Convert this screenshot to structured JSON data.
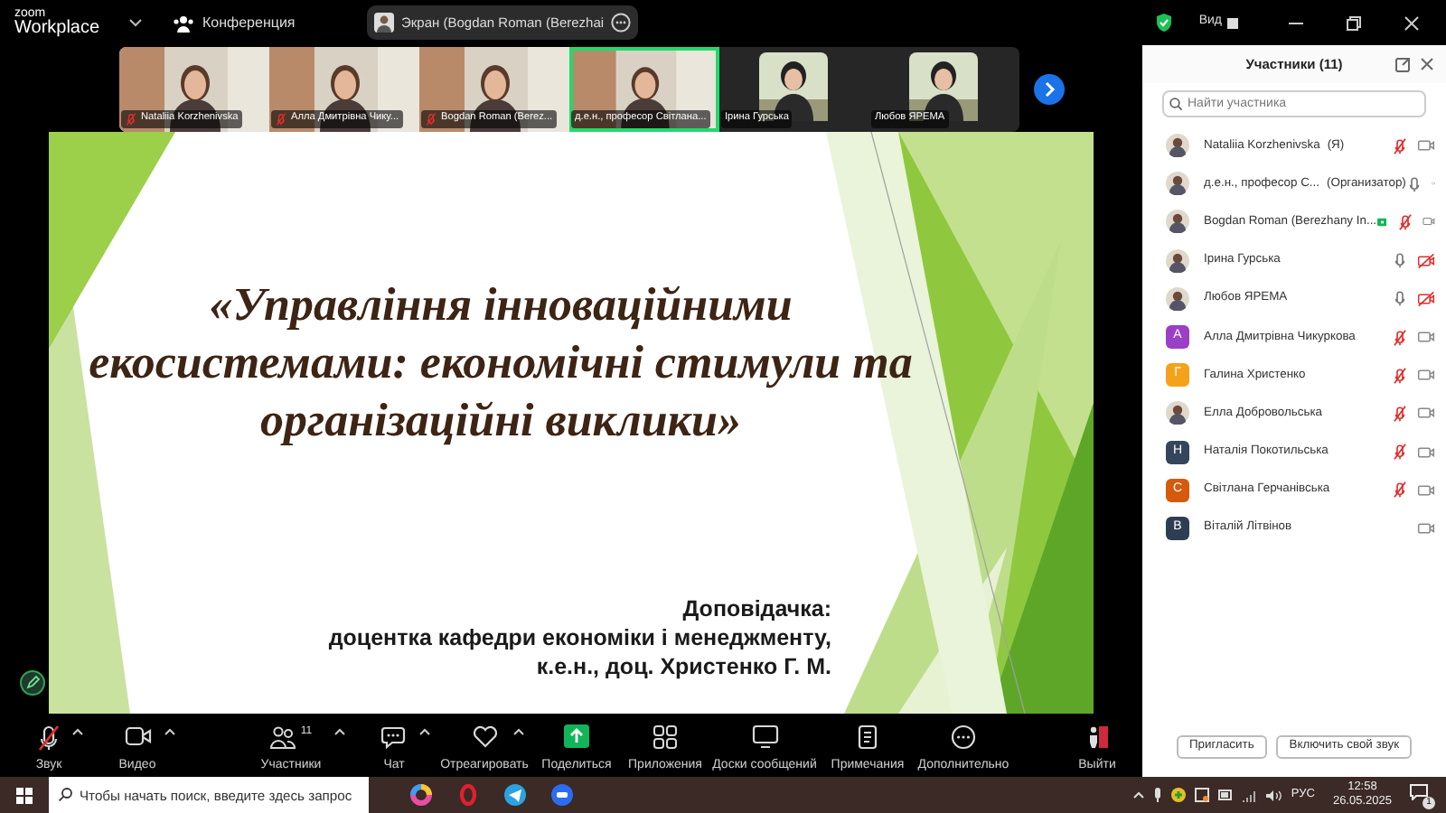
{
  "app": {
    "logo_top": "zoom",
    "logo_bottom": "Workplace",
    "meeting_label": "Конференция"
  },
  "share_pill": {
    "text": "Экран (Bogdan Roman (Berezhai"
  },
  "window_controls": {
    "view_label": "Вид"
  },
  "video_strip": [
    {
      "kind": "video",
      "name": "Nataliia Korzhenivska",
      "muted": true,
      "speaking": false
    },
    {
      "kind": "video",
      "name": "Алла Дмитрівна Чику...",
      "muted": true,
      "speaking": false
    },
    {
      "kind": "video",
      "name": "Bogdan Roman (Berez...",
      "muted": true,
      "speaking": false
    },
    {
      "kind": "video",
      "name": "д.е.н., професор Світлана...",
      "muted": false,
      "speaking": true
    },
    {
      "name": "Ірина Гурська",
      "muted": false,
      "speaking": false
    },
    {
      "name": "Любов ЯРЕМА",
      "muted": false,
      "speaking": false
    }
  ],
  "slide": {
    "title_lines": [
      "«Управління інноваційними",
      "екосистемами: економічні стимули та",
      "організаційні виклики»"
    ],
    "presenter_lines": [
      "Доповідачка:",
      "доцентка кафедри економіки і менеджменту,",
      "к.е.н., доц. Христенко Г. М."
    ]
  },
  "participants_panel": {
    "title": "Участники (11)",
    "search": {
      "placeholder": "Найти участника"
    },
    "items": [
      {
        "name": "Nataliia Korzhenivska",
        "role": "(Я)",
        "has_audio": true,
        "muted": true,
        "video_off": false,
        "sharing": false
      },
      {
        "name": "д.е.н., професор С...",
        "role": "(Организатор)",
        "has_audio": true,
        "muted": false,
        "video_off": false,
        "sharing": false
      },
      {
        "name": "Bogdan Roman (Berezhany In...",
        "has_audio": true,
        "muted": true,
        "video_off": false,
        "sharing": true
      },
      {
        "name": "Ірина Гурська",
        "has_audio": true,
        "muted": false,
        "video_off": true,
        "sharing": false
      },
      {
        "name": "Любов ЯРЕМА",
        "has_audio": true,
        "muted": false,
        "video_off": true,
        "sharing": false
      },
      {
        "letter": "А",
        "color": "#9b3fc6",
        "name": "Алла Дмитрівна Чикуркова",
        "has_audio": true,
        "muted": true,
        "video_off": false,
        "sharing": false
      },
      {
        "letter": "Г",
        "color": "#f5a21b",
        "name": "Галина Христенко",
        "has_audio": true,
        "muted": true,
        "video_off": false,
        "sharing": false
      },
      {
        "name": "Елла Добровольська",
        "has_audio": true,
        "muted": true,
        "video_off": false,
        "sharing": false
      },
      {
        "letter": "Н",
        "color": "#34465c",
        "name": "Наталія Покотильська",
        "has_audio": true,
        "muted": true,
        "video_off": false,
        "sharing": false
      },
      {
        "letter": "С",
        "color": "#d55a0c",
        "name": "Світлана Герчанівська",
        "has_audio": true,
        "muted": true,
        "video_off": false,
        "sharing": false
      },
      {
        "letter": "В",
        "color": "#2e3e52",
        "name": "Віталій Літвінов",
        "has_audio": false,
        "video_off": false,
        "sharing": false
      }
    ],
    "buttons": [
      "Пригласить",
      "Включить свой звук"
    ]
  },
  "toolbar": [
    {
      "kind": "mic-muted",
      "label": "Звук",
      "caret": true
    },
    {
      "kind": "video",
      "label": "Видео",
      "caret": true
    },
    {
      "kind": "people",
      "label": "Участники",
      "badge": "11",
      "caret": true
    },
    {
      "kind": "chat",
      "label": "Чат",
      "caret": true
    },
    {
      "kind": "heart",
      "label": "Отреагировать",
      "caret": true
    },
    {
      "kind": "share",
      "label": "Поделиться",
      "caret": false
    },
    {
      "kind": "apps",
      "label": "Приложения",
      "caret": false
    },
    {
      "kind": "board",
      "label": "Доски сообщений",
      "caret": false
    },
    {
      "kind": "notes",
      "label": "Примечания",
      "caret": false
    },
    {
      "kind": "more",
      "label": "Дополнительно",
      "caret": false
    },
    {
      "kind": "leave",
      "label": "Выйти",
      "caret": false
    }
  ],
  "taskbar": {
    "search": {
      "placeholder": "Чтобы начать поиск, введите здесь запрос"
    },
    "language": "РУС",
    "time": "12:58",
    "date": "26.05.2025",
    "notifications": "1"
  }
}
